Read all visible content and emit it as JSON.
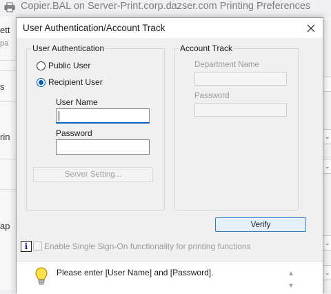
{
  "background_window": {
    "title": "Copier.BAL on Server-Print.corp.dazser.com Printing Preferences",
    "fragments": [
      "ett",
      "pa",
      "s",
      "rin",
      "ap"
    ]
  },
  "dialog": {
    "title": "User Authentication/Account Track",
    "close_icon": "close-icon"
  },
  "user_auth": {
    "group_title": "User Authentication",
    "public_user_label": "Public User",
    "recipient_user_label": "Recipient User",
    "selected": "Recipient User",
    "user_name_label": "User Name",
    "user_name_value": "",
    "password_label": "Password",
    "password_value": "",
    "server_setting_label": "Server Setting..."
  },
  "account_track": {
    "group_title": "Account Track",
    "department_name_label": "Department Name",
    "department_name_value": "",
    "password_label": "Password",
    "password_value": ""
  },
  "verify_label": "Verify",
  "sso_label": "Enable Single Sign-On functionality for printing functions",
  "message": "Please enter [User Name] and [Password].",
  "colors": {
    "accent": "#005fb8",
    "disabled_text": "#9b9b9b",
    "dialog_bg": "#f0f0f0"
  }
}
